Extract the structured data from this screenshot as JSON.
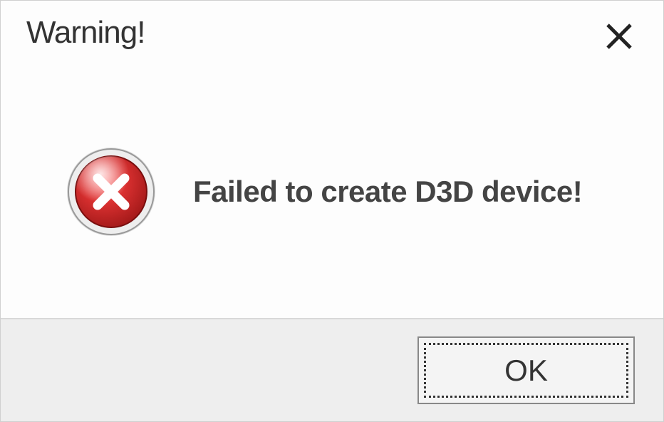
{
  "dialog": {
    "title": "Warning!",
    "message": "Failed to create D3D device!",
    "ok_label": "OK"
  }
}
